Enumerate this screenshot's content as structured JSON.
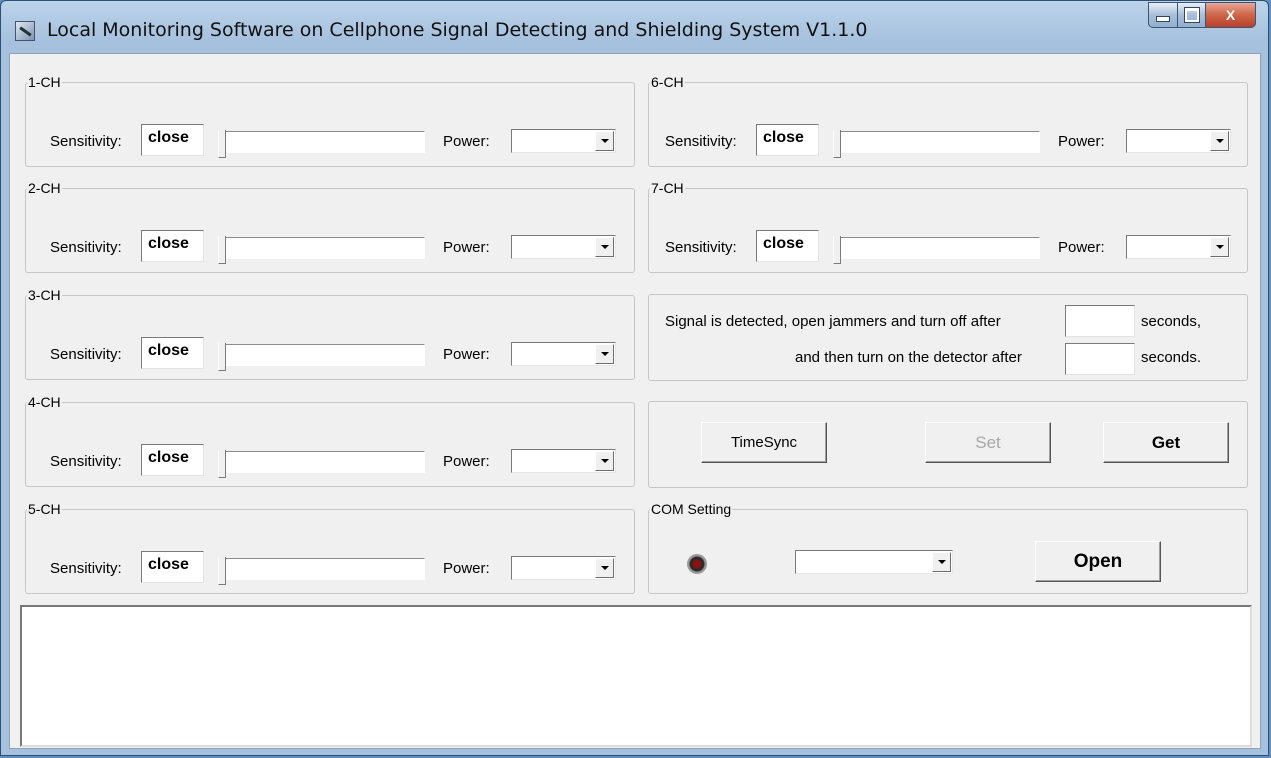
{
  "window": {
    "title": "Local Monitoring Software on Cellphone Signal Detecting and Shielding System V1.1.0",
    "close_glyph": "X"
  },
  "labels": {
    "sensitivity": "Sensitivity:",
    "power": "Power:"
  },
  "channels": [
    {
      "name": "1-CH",
      "sensitivity": "close",
      "power": ""
    },
    {
      "name": "2-CH",
      "sensitivity": "close",
      "power": ""
    },
    {
      "name": "3-CH",
      "sensitivity": "close",
      "power": ""
    },
    {
      "name": "4-CH",
      "sensitivity": "close",
      "power": ""
    },
    {
      "name": "5-CH",
      "sensitivity": "close",
      "power": ""
    },
    {
      "name": "6-CH",
      "sensitivity": "close",
      "power": ""
    },
    {
      "name": "7-CH",
      "sensitivity": "close",
      "power": ""
    }
  ],
  "timer": {
    "line1": "Signal is detected, open jammers and turn off after",
    "seconds1": "seconds,",
    "line2": "and then turn on the detector after",
    "seconds2": "seconds.",
    "value1": "",
    "value2": ""
  },
  "actions": {
    "timesync": "TimeSync",
    "set": "Set",
    "get": "Get"
  },
  "com": {
    "legend": "COM Setting",
    "port": "",
    "open": "Open"
  },
  "log": {
    "text": ""
  },
  "icons": {
    "app": "satellite-dish-icon",
    "led": "status-led-icon"
  }
}
